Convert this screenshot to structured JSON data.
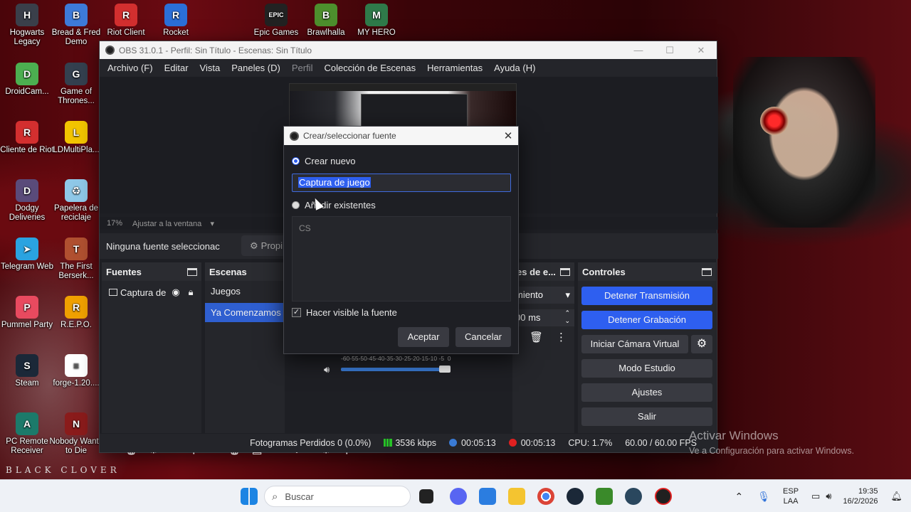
{
  "desktop": {
    "icons": [
      {
        "label": "Hogwarts Legacy",
        "color": "#3a3f4a",
        "glyph": "H"
      },
      {
        "label": "Bread & Fred Demo",
        "color": "#3d7ad8",
        "glyph": "B"
      },
      {
        "label": "Riot Client",
        "color": "#d32f2f",
        "glyph": "R"
      },
      {
        "label": "Rocket",
        "color": "#2b6fd8",
        "glyph": "R"
      },
      {
        "label": "Epic Games",
        "color": "#222222",
        "glyph": "EPIC"
      },
      {
        "label": "Brawlhalla",
        "color": "#4d8f2d",
        "glyph": "B"
      },
      {
        "label": "MY HERO",
        "color": "#2f7a4a",
        "glyph": "M"
      },
      {
        "label": "DroidCam...",
        "color": "#4caf50",
        "glyph": "D"
      },
      {
        "label": "Game of Thrones...",
        "color": "#34404f",
        "glyph": "G"
      },
      {
        "label": "Cliente de Riot",
        "color": "#d32f2f",
        "glyph": "R"
      },
      {
        "label": "LDMultiPla...",
        "color": "#f2c400",
        "glyph": "L"
      },
      {
        "label": "Dodgy Deliveries",
        "color": "#5a4b7a",
        "glyph": "D"
      },
      {
        "label": "Papelera de reciclaje",
        "color": "#8fc8e8",
        "glyph": "♻"
      },
      {
        "label": "Telegram Web",
        "color": "#2aa3e0",
        "glyph": "➤"
      },
      {
        "label": "The First Berserk...",
        "color": "#b05030",
        "glyph": "T"
      },
      {
        "label": "Pummel Party",
        "color": "#e84a5f",
        "glyph": "P"
      },
      {
        "label": "R.E.P.O.",
        "color": "#f0a000",
        "glyph": "R"
      },
      {
        "label": "Steam",
        "color": "#1b2838",
        "glyph": "S"
      },
      {
        "label": "forge-1.20....",
        "color": "#ffffff",
        "glyph": "≡"
      },
      {
        "label": "PC Remote Receiver",
        "color": "#1c7a6a",
        "glyph": "A"
      },
      {
        "label": "Nobody Wants to Die",
        "color": "#8a1b1b",
        "glyph": "N"
      }
    ],
    "wallpaper_caption": "BLACK CLOVER",
    "activation_title": "Activar Windows",
    "activation_subtitle": "Ve a Configuración para activar Windows."
  },
  "obs": {
    "title": "OBS 31.0.1 - Perfil: Sin Título - Escenas: Sin Título",
    "menu": [
      "Archivo (F)",
      "Editar",
      "Vista",
      "Paneles (D)",
      "Perfil",
      "Colección de Escenas",
      "Herramientas",
      "Ayuda (H)"
    ],
    "zoom": "17%",
    "fit_label": "Ajustar a la ventana",
    "no_source_selected": "Ninguna fuente seleccionac",
    "properties_label": "Propi",
    "docks": {
      "sources": {
        "title": "Fuentes",
        "items": [
          "Captura de"
        ]
      },
      "scenes": {
        "title": "Escenas",
        "items": [
          "Juegos",
          "Ya Comenzamos"
        ],
        "active_index": 1
      },
      "transitions": {
        "title": "es de e...",
        "mode": "miento",
        "duration": "00 ms"
      },
      "controls": {
        "title": "Controles",
        "buttons": [
          "Detener Transmisión",
          "Detener Grabación",
          "Iniciar Cámara Virtual",
          "Modo Estudio",
          "Ajustes",
          "Salir"
        ]
      }
    },
    "mixer_ticks": "-60-55-50-45-40-35-30-25-20-15-10 -5  0",
    "status": {
      "dropped": "Fotogramas Perdidos 0 (0.0%)",
      "bitrate": "3536 kbps",
      "stream_time": "00:05:13",
      "rec_time": "00:05:13",
      "cpu": "CPU: 1.7%",
      "fps": "60.00 / 60.00 FPS",
      "stream_color": "#3a7bd5",
      "rec_color": "#e02020"
    }
  },
  "dialog": {
    "title": "Crear/seleccionar fuente",
    "create_new_label": "Crear nuevo",
    "name_value": "Captura de juego",
    "add_existing_label": "Añadir existentes",
    "existing_items": [
      "CS"
    ],
    "visible_label": "Hacer visible la fuente",
    "visible_checked": true,
    "ok_label": "Aceptar",
    "cancel_label": "Cancelar"
  },
  "taskbar": {
    "search_placeholder": "Buscar",
    "lang": "ESP",
    "layout": "LAA",
    "time": "19:35",
    "date": "16/2/2026"
  }
}
